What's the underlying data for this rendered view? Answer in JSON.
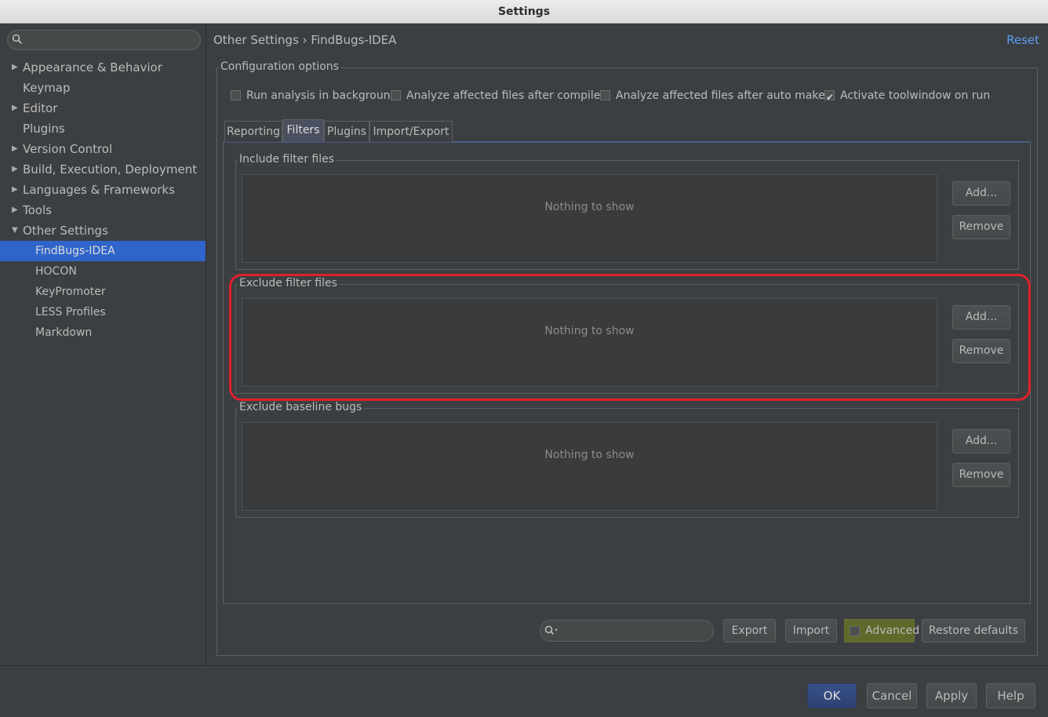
{
  "window": {
    "title": "Settings"
  },
  "search": {
    "placeholder": "",
    "value": ""
  },
  "sidebar": {
    "items": [
      {
        "label": "Appearance & Behavior",
        "expandable": true,
        "expanded": false
      },
      {
        "label": "Keymap",
        "expandable": false
      },
      {
        "label": "Editor",
        "expandable": true,
        "expanded": false
      },
      {
        "label": "Plugins",
        "expandable": false
      },
      {
        "label": "Version Control",
        "expandable": true,
        "expanded": false
      },
      {
        "label": "Build, Execution, Deployment",
        "expandable": true,
        "expanded": false
      },
      {
        "label": "Languages & Frameworks",
        "expandable": true,
        "expanded": false
      },
      {
        "label": "Tools",
        "expandable": true,
        "expanded": false
      },
      {
        "label": "Other Settings",
        "expandable": true,
        "expanded": true
      }
    ],
    "children": [
      {
        "label": "FindBugs-IDEA",
        "selected": true
      },
      {
        "label": "HOCON"
      },
      {
        "label": "KeyPromoter"
      },
      {
        "label": "LESS Profiles"
      },
      {
        "label": "Markdown"
      }
    ]
  },
  "header": {
    "breadcrumb": "Other Settings › FindBugs-IDEA",
    "reset_label": "Reset"
  },
  "config": {
    "title": "Configuration options",
    "checkboxes": [
      {
        "label": "Run analysis in background",
        "checked": false
      },
      {
        "label": "Analyze affected files after compile",
        "checked": false
      },
      {
        "label": "Analyze affected files after auto make",
        "checked": false
      },
      {
        "label": "Activate toolwindow on run",
        "checked": true
      }
    ]
  },
  "tabs": [
    {
      "label": "Reporting",
      "active": false
    },
    {
      "label": "Filters",
      "active": true
    },
    {
      "label": "Plugins",
      "active": false
    },
    {
      "label": "Import/Export",
      "active": false
    }
  ],
  "filters": {
    "include": {
      "title": "Include filter files",
      "empty": "Nothing to show",
      "add": "Add...",
      "remove": "Remove"
    },
    "exclude": {
      "title": "Exclude filter files",
      "empty": "Nothing to show",
      "add": "Add...",
      "remove": "Remove"
    },
    "baseline": {
      "title": "Exclude baseline bugs",
      "empty": "Nothing to show",
      "add": "Add...",
      "remove": "Remove"
    }
  },
  "bottom_bar": {
    "search_placeholder": "",
    "export_label": "Export",
    "import_label": "Import",
    "advanced_label": "Advanced",
    "advanced_checked": false,
    "restore_label": "Restore defaults"
  },
  "footer": {
    "ok_label": "OK",
    "cancel_label": "Cancel",
    "apply_label": "Apply",
    "help_label": "Help"
  },
  "colors": {
    "background": "#3c3f41",
    "selection": "#2f65ca",
    "link": "#589df6",
    "highlight": "#e0202b",
    "advanced": "#5e6a2a"
  }
}
